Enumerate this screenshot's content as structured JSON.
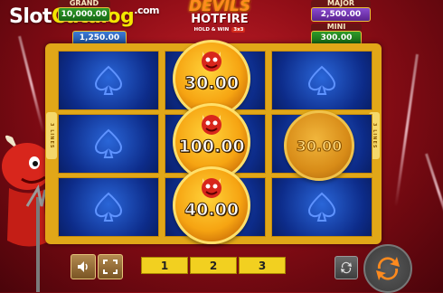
{
  "watermark": {
    "part1": "Slot",
    "part2": "Catalog",
    "suffix": ".com"
  },
  "game": {
    "logo_line1": "DEVILS",
    "logo_line2": "HOTFIRE",
    "logo_line3": "HOLD & WIN",
    "logo_badge": "3x3"
  },
  "jackpots": {
    "grand": {
      "label": "GRAND",
      "value": "10,000.00"
    },
    "minor": {
      "value": "1,250.00"
    },
    "major": {
      "label": "MAJOR",
      "value": "2,500.00"
    },
    "mini": {
      "label": "MINI",
      "value": "300.00"
    }
  },
  "reels": {
    "side_label_left": "3 LINES",
    "side_label_right": "3 LINES",
    "coins": [
      {
        "value": "30.00"
      },
      {
        "value": "100.00"
      },
      {
        "value": "40.00"
      },
      {
        "value": "30.00"
      }
    ]
  },
  "controls": {
    "sound_icon": "speaker-icon",
    "fullscreen_icon": "fullscreen-icon",
    "autoplay_icon": "autoplay-icon",
    "spin_icon": "spin-arrows-icon",
    "lines": [
      "1",
      "2",
      "3"
    ]
  },
  "colors": {
    "frame": "#e1a718",
    "cell": "#0d2c8a",
    "background": "#8e0d16",
    "line_button": "#f2d020"
  }
}
